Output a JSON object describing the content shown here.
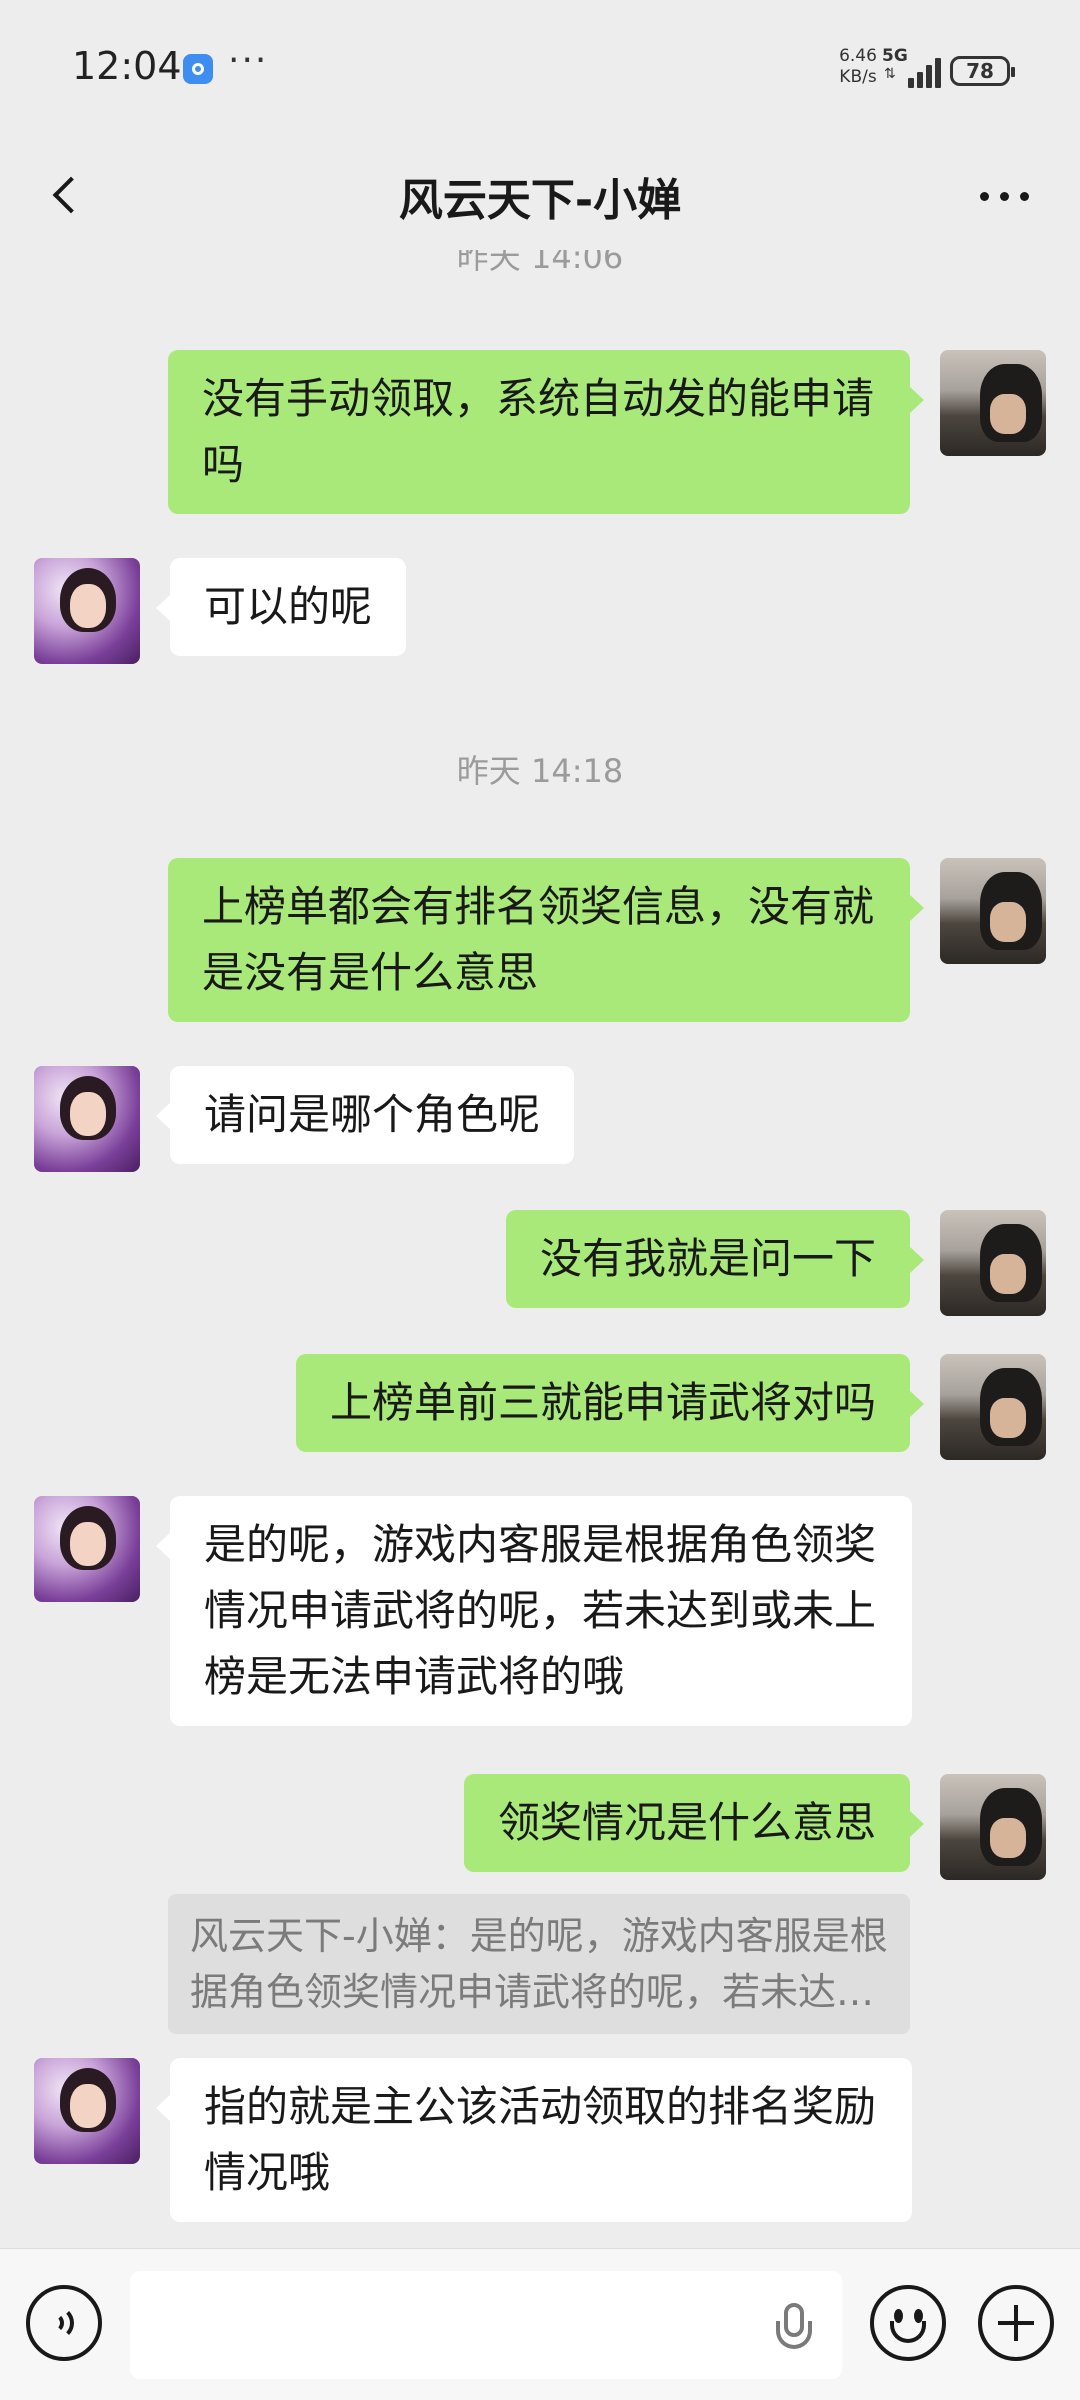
{
  "status_bar": {
    "time": "12:04",
    "more": "···",
    "net_speed_value": "6.46",
    "net_speed_unit": "KB/s",
    "network": "5G",
    "battery": "78"
  },
  "header": {
    "title": "风云天下-小婵"
  },
  "chat": {
    "timestamps": [
      "昨天 14:06",
      "昨天 14:18"
    ],
    "messages": [
      {
        "side": "sent",
        "text": "没有手动领取，系统自动发的能申请吗"
      },
      {
        "side": "recv",
        "text": "可以的呢"
      },
      {
        "side": "sent",
        "text": "上榜单都会有排名领奖信息，没有就是没有是什么意思"
      },
      {
        "side": "recv",
        "text": "请问是哪个角色呢"
      },
      {
        "side": "sent",
        "text": "没有我就是问一下"
      },
      {
        "side": "sent",
        "text": "上榜单前三就能申请武将对吗"
      },
      {
        "side": "recv",
        "text": "是的呢，游戏内客服是根据角色领奖情况申请武将的呢，若未达到或未上榜是无法申请武将的哦"
      },
      {
        "side": "sent",
        "text": "领奖情况是什么意思"
      },
      {
        "side": "recv",
        "text": "指的就是主公该活动领取的排名奖励情况哦"
      }
    ],
    "quote": "风云天下-小婵：是的呢，游戏内客服是根据角色领奖情况申请武将的呢，若未达…"
  },
  "input_bar": {
    "placeholder": ""
  },
  "colors": {
    "sent_bubble": "#a9e97a",
    "recv_bubble": "#ffffff",
    "background": "#ededed"
  }
}
